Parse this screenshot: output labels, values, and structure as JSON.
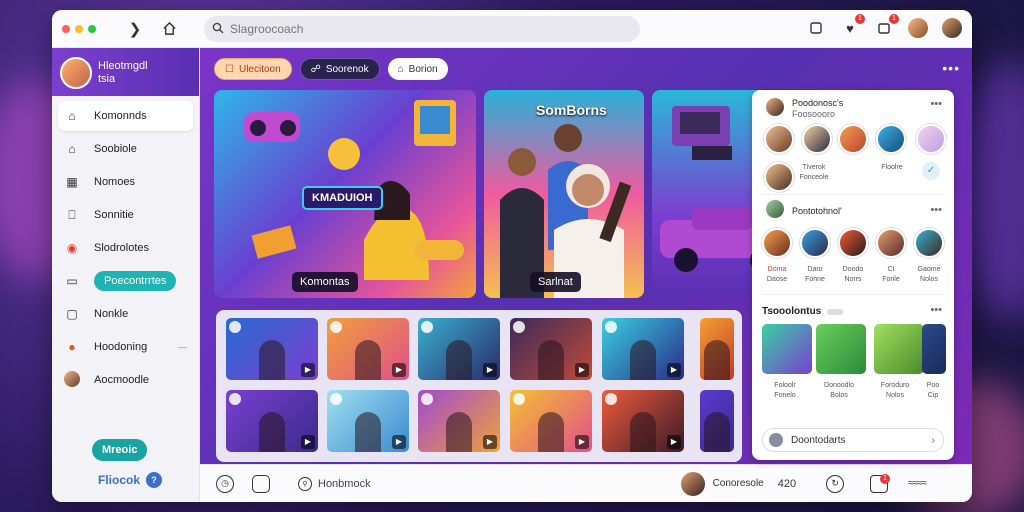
{
  "titlebar": {
    "search_placeholder": "Slagroocoach",
    "dot_colors": [
      "#ff5f57",
      "#febc2e",
      "#28c840"
    ],
    "notif_count_1": "1",
    "notif_count_2": "1"
  },
  "sidebar": {
    "profile_name": "Hleotmgdl",
    "profile_sub": "tsia",
    "items": [
      {
        "label": "Komonnds",
        "icon": "home-icon"
      },
      {
        "label": "Soobiole",
        "icon": "home-outline-icon"
      },
      {
        "label": "Nomoes",
        "icon": "grid-icon"
      },
      {
        "label": "Sonnitie",
        "icon": "lock-icon"
      },
      {
        "label": "Slodrolotes",
        "icon": "record-icon"
      },
      {
        "label": "Poecontrrtes",
        "icon": "puzzle-icon"
      },
      {
        "label": "Nonkle",
        "icon": "square-icon"
      },
      {
        "label": "Hoodoning",
        "icon": "fire-icon"
      },
      {
        "label": "Aocmoodle",
        "icon": "user-icon"
      }
    ],
    "premium_label": "Mreoic",
    "flock_label": "Fliocok",
    "flock_badge": "?"
  },
  "main": {
    "chips": [
      {
        "label": "Ulecitoon",
        "icon": "ticket-icon"
      },
      {
        "label": "Soorenok",
        "icon": "link-icon"
      },
      {
        "label": "Borion",
        "icon": "house-icon"
      }
    ],
    "heroes": [
      {
        "label": "Komontas",
        "sign": "KMADUIOH"
      },
      {
        "label": "Sarlnat",
        "title": "SomBorns"
      },
      {
        "label": ""
      }
    ]
  },
  "rpanel": {
    "sec1_title": "Poodonosc's",
    "sec1_sub": "Foosoooro",
    "row1_caps": [
      "Tiverok",
      "Fonceole",
      "Floolre"
    ],
    "sec2_title": "Pontotohnol'",
    "row2_caps": [
      "Doma",
      "Daro",
      "Doodo",
      "Ct",
      "Gaome"
    ],
    "row2_sub": [
      "Daose",
      "Fonne",
      "Norrs",
      "Fonle",
      "Nolos"
    ],
    "sec3_title": "Tsooolontus",
    "tile_caps": [
      "Foloolr",
      "Donoodlo",
      "Foroduro",
      "Poo"
    ],
    "tile_sub": [
      "Fonelo",
      "Bolos",
      "Nolos",
      "Cip"
    ],
    "footer_label": "Doontodarts"
  },
  "bottombar": {
    "search_label": "Honbmock",
    "user_label": "Conoresole",
    "code_label": "420",
    "badge": "1"
  }
}
